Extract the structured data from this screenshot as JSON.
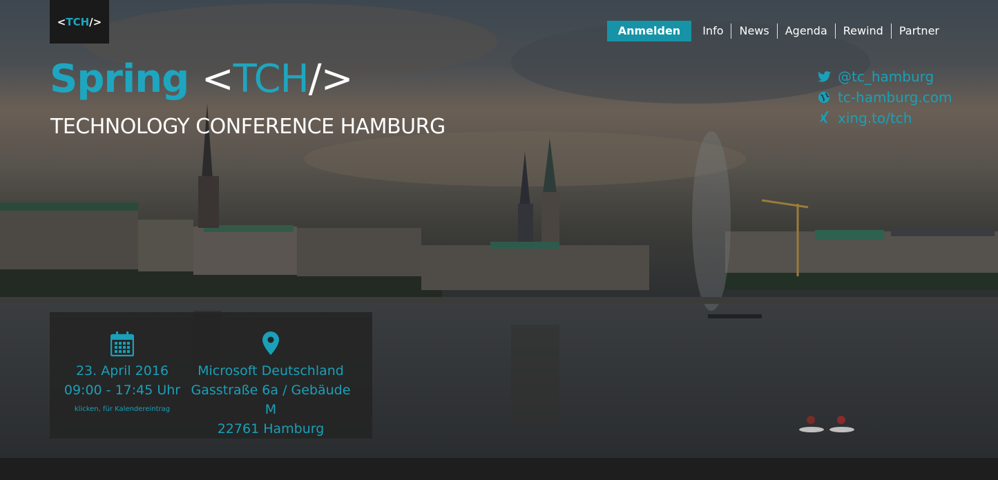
{
  "logo": {
    "prefix": "<",
    "brand": "TCH",
    "suffix": "/>"
  },
  "nav": {
    "register_label": "Anmelden",
    "items": [
      "Info",
      "News",
      "Agenda",
      "Rewind",
      "Partner"
    ]
  },
  "hero": {
    "title_spring": "Spring",
    "title_open": "<",
    "title_brand": "TCH",
    "title_close": "/>",
    "subtitle": "TECHNOLOGY CONFERENCE HAMBURG"
  },
  "social": {
    "twitter": "@tc_hamburg",
    "website": "tc-hamburg.com",
    "xing": "xing.to/tch"
  },
  "event": {
    "date": "23. April 2016",
    "time": "09:00 - 17:45 Uhr",
    "calendar_hint": "klicken, für Kalendereintrag",
    "venue": "Microsoft Deutschland",
    "street": "Gasstraße 6a / Gebäude M",
    "city": "22761 Hamburg"
  },
  "colors": {
    "accent": "#1ea6c0",
    "button": "#1793a8",
    "footer": "#1e1e1e"
  }
}
